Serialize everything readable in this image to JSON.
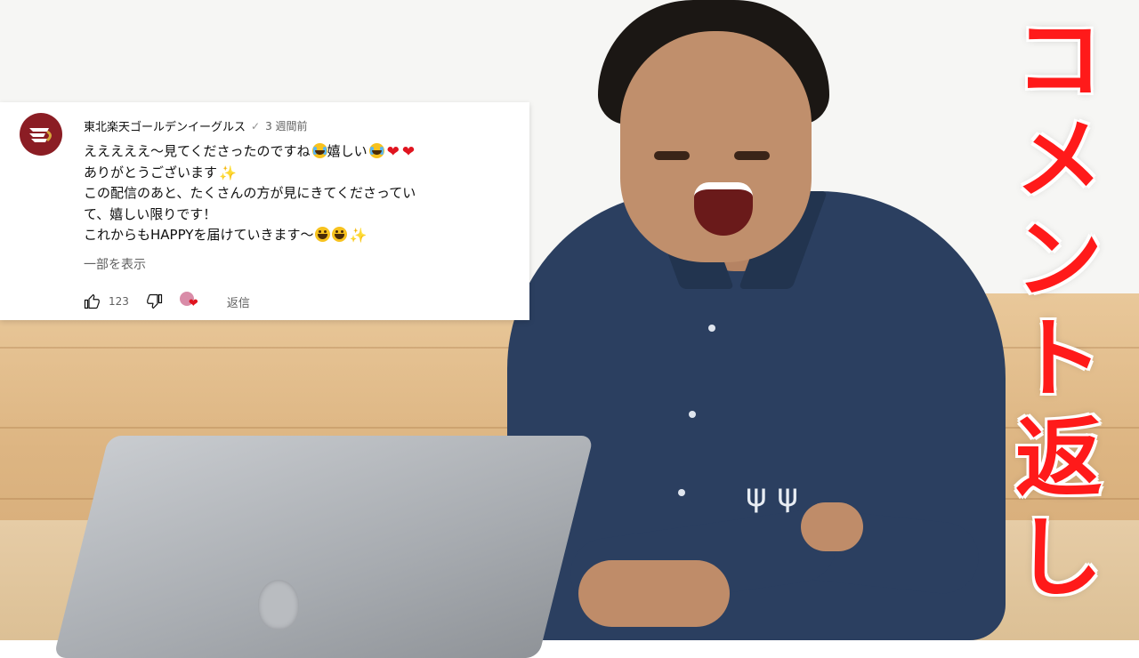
{
  "overlay_title": [
    "コ",
    "メ",
    "ン",
    "ト",
    "返",
    "し"
  ],
  "comment": {
    "author": "東北楽天ゴールデンイーグルス",
    "verified_icon": "check-icon",
    "verified_mark": "✓",
    "time": "3 週間前",
    "avatar_icon": "eagles-logo-icon",
    "lines": [
      "えええええ～見てくださったのですね",
      "嬉しい",
      "ありがとうございます",
      "この配信のあと、たくさんの方が見にきてくださってい",
      "て、嬉しい限りです！",
      "これからもHAPPYを届けていきます～"
    ],
    "emoji": {
      "heart": "❤",
      "sparkle": "✨"
    },
    "show_more": "一部を表示",
    "like_count": "123",
    "reply_label": "返信"
  },
  "colors": {
    "title_red": "#ff1a1a",
    "avatar_bg": "#8b1d24",
    "meta_gray": "#606060",
    "heart_red": "#e0141f"
  }
}
